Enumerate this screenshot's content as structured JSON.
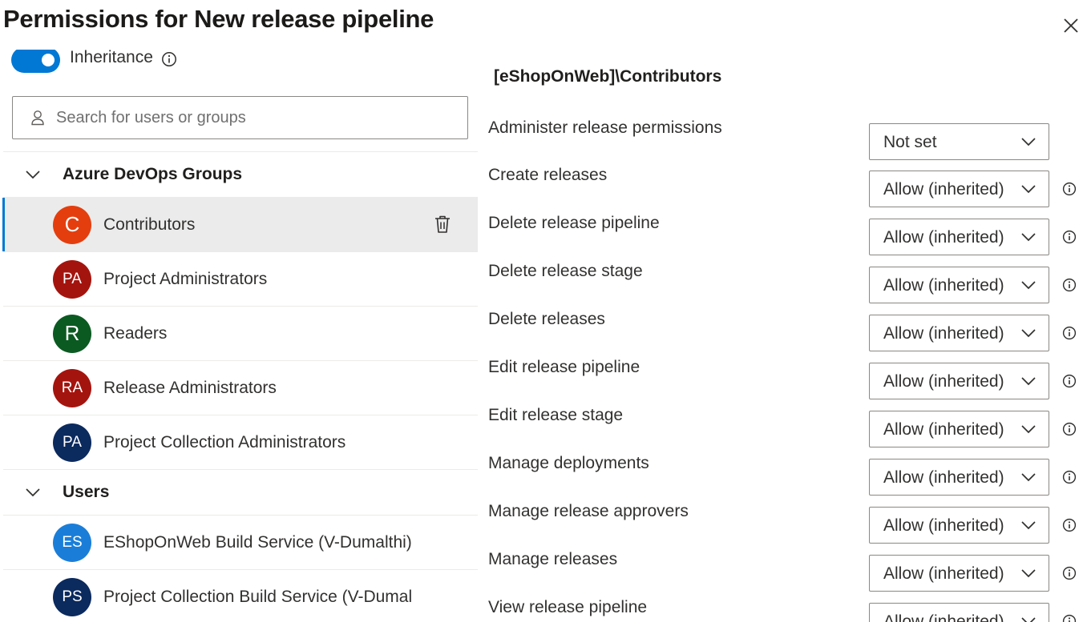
{
  "dialog": {
    "title": "Permissions for New release pipeline"
  },
  "left_pane": {
    "inheritance_label": "Inheritance",
    "search": {
      "placeholder": "Search for users or groups",
      "value": ""
    },
    "groups": [
      {
        "title": "Azure DevOps Groups",
        "items": [
          {
            "label": "Contributors",
            "initials": "C",
            "color": "#e43e0f",
            "selected": true
          },
          {
            "label": "Project Administrators",
            "initials": "PA",
            "color": "#a4140e",
            "selected": false
          },
          {
            "label": "Readers",
            "initials": "R",
            "color": "#0b5a22",
            "selected": false
          },
          {
            "label": "Release Administrators",
            "initials": "RA",
            "color": "#a4140e",
            "selected": false
          },
          {
            "label": "Project Collection Administrators",
            "initials": "PA",
            "color": "#0b2a5e",
            "selected": false
          }
        ]
      },
      {
        "title": "Users",
        "items": [
          {
            "label": "EShopOnWeb Build Service (V-Dumalthi)",
            "initials": "ES",
            "color": "#1a7ed9",
            "selected": false
          },
          {
            "label": "Project Collection Build Service (V-Dumal",
            "initials": "PS",
            "color": "#0b2a5e",
            "selected": false
          }
        ]
      }
    ]
  },
  "right_pane": {
    "section_title": "[eShopOnWeb]\\Contributors",
    "permissions": [
      {
        "label": "Administer release permissions",
        "value": "Not set",
        "has_info": false
      },
      {
        "label": "Create releases",
        "value": "Allow (inherited)",
        "has_info": true
      },
      {
        "label": "Delete release pipeline",
        "value": "Allow (inherited)",
        "has_info": true
      },
      {
        "label": "Delete release stage",
        "value": "Allow (inherited)",
        "has_info": true
      },
      {
        "label": "Delete releases",
        "value": "Allow (inherited)",
        "has_info": true
      },
      {
        "label": "Edit release pipeline",
        "value": "Allow (inherited)",
        "has_info": true
      },
      {
        "label": "Edit release stage",
        "value": "Allow (inherited)",
        "has_info": true
      },
      {
        "label": "Manage deployments",
        "value": "Allow (inherited)",
        "has_info": true
      },
      {
        "label": "Manage release approvers",
        "value": "Allow (inherited)",
        "has_info": true
      },
      {
        "label": "Manage releases",
        "value": "Allow (inherited)",
        "has_info": true
      },
      {
        "label": "View release pipeline",
        "value": "Allow (inherited)",
        "has_info": true
      }
    ]
  },
  "icons": {
    "close": "close-icon",
    "info": "info-icon",
    "person": "person-icon",
    "chevron": "chevron-down-icon",
    "trash": "trash-icon"
  },
  "colors": {
    "accent": "#0078d4",
    "selected_row": "#ebebeb",
    "border": "#8a8886"
  }
}
